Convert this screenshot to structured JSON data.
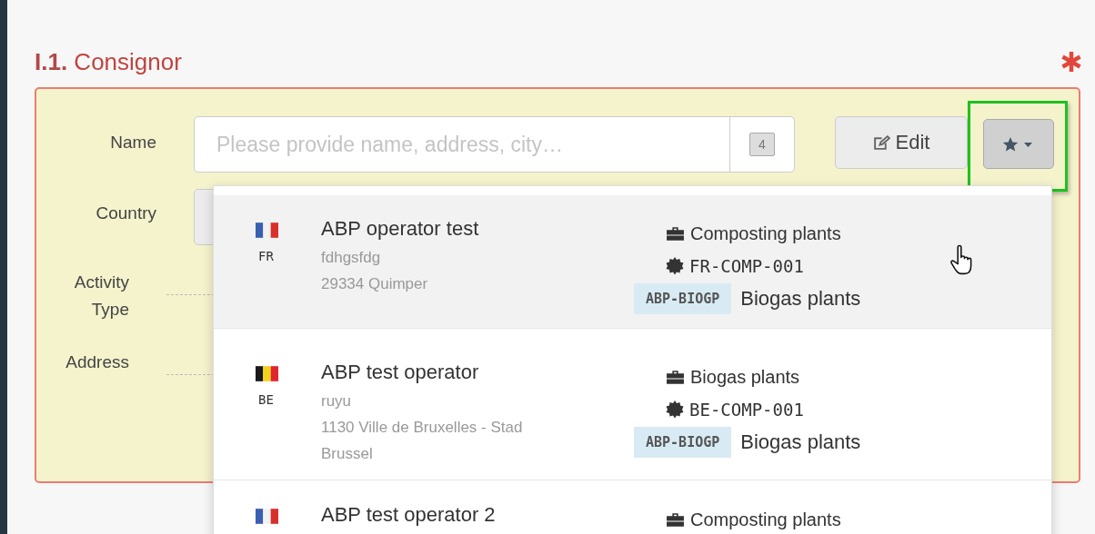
{
  "section": {
    "number": "I.1.",
    "title": "Consignor",
    "required": true
  },
  "form": {
    "fields": [
      {
        "label": "Name",
        "kind": "search"
      },
      {
        "label": "Country",
        "kind": "select"
      },
      {
        "label": "Activity Type",
        "kind": "dashed"
      },
      {
        "label": "Address",
        "kind": "dashed"
      }
    ],
    "name_field": {
      "placeholder": "Please provide name, address, city…",
      "count": "4"
    },
    "edit_button": "Edit",
    "favourites_button": {
      "highlighted": true
    }
  },
  "dropdown": {
    "items": [
      {
        "kind": "france",
        "country": "FR",
        "name": "ABP operator test",
        "lines": [
          "fdhgsfdg",
          "29334 Quimper"
        ],
        "activity": "Composting plants",
        "approval": "FR-COMP-001",
        "tag": "ABP-BIOGP",
        "tag_text": "Biogas plants",
        "selected": true
      },
      {
        "kind": "belgium",
        "country": "BE",
        "name": "ABP test operator",
        "lines": [
          "ruyu",
          "1130 Ville de Bruxelles - Stad Brussel"
        ],
        "activity": "Biogas plants",
        "approval": "BE-COMP-001",
        "tag": "ABP-BIOGP",
        "tag_text": "Biogas plants",
        "selected": false
      },
      {
        "kind": "france",
        "name": "ABP test operator 2",
        "activity": "Composting plants",
        "selected": false
      }
    ]
  }
}
